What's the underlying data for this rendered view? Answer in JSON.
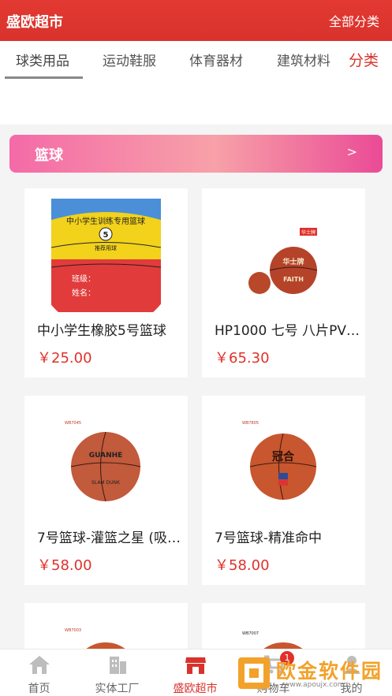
{
  "header": {
    "title": "盛欧超市",
    "all_categories": "全部分类"
  },
  "tabs": {
    "items": [
      {
        "label": "球类用品"
      },
      {
        "label": "运动鞋服"
      },
      {
        "label": "体育器材"
      },
      {
        "label": "建筑材料"
      }
    ],
    "more": "分类"
  },
  "banner": {
    "label": "篮球",
    "arrow": ">"
  },
  "products": [
    {
      "name": "中小学生橡胶5号篮球",
      "price": "￥25.00",
      "image": "basketball-colored",
      "image_text": [
        "中小学生训练专用篮球",
        "5",
        "推荐用球",
        "班级：",
        "姓名："
      ]
    },
    {
      "name": "HP1000 七号 八片PV…",
      "price": "￥65.30",
      "image": "basketball-pair",
      "image_text": [
        "华士牌",
        "FAITH"
      ]
    },
    {
      "name": "7号篮球-灌篮之星 (吸…",
      "price": "￥58.00",
      "image": "basketball-brown",
      "image_text": [
        "WB7045",
        "GUANHE",
        "SLAM DUNK"
      ]
    },
    {
      "name": "7号篮球-精准命中",
      "price": "￥58.00",
      "image": "basketball-orange",
      "image_text": [
        "WB7805",
        "冠合"
      ]
    },
    {
      "name": "",
      "price": "",
      "image": "basketball-partial",
      "image_text": [
        "WB7003"
      ]
    },
    {
      "name": "",
      "price": "",
      "image": "basketball-partial",
      "image_text": [
        "WB7007"
      ]
    }
  ],
  "bottom_nav": [
    {
      "label": "首页",
      "icon": "home-icon"
    },
    {
      "label": "实体工厂",
      "icon": "building-icon"
    },
    {
      "label": "盛欧超市",
      "icon": "store-icon"
    },
    {
      "label": "购物车",
      "icon": "cart-icon",
      "badge": "1"
    },
    {
      "label": "我的",
      "icon": "user-icon"
    }
  ],
  "watermark": {
    "text": "欧金软件园",
    "url": "www.apoujx.com"
  },
  "colors": {
    "brand_red": "#d9322c",
    "price_red": "#e0312a",
    "banner_pink": "#f46aa7"
  }
}
